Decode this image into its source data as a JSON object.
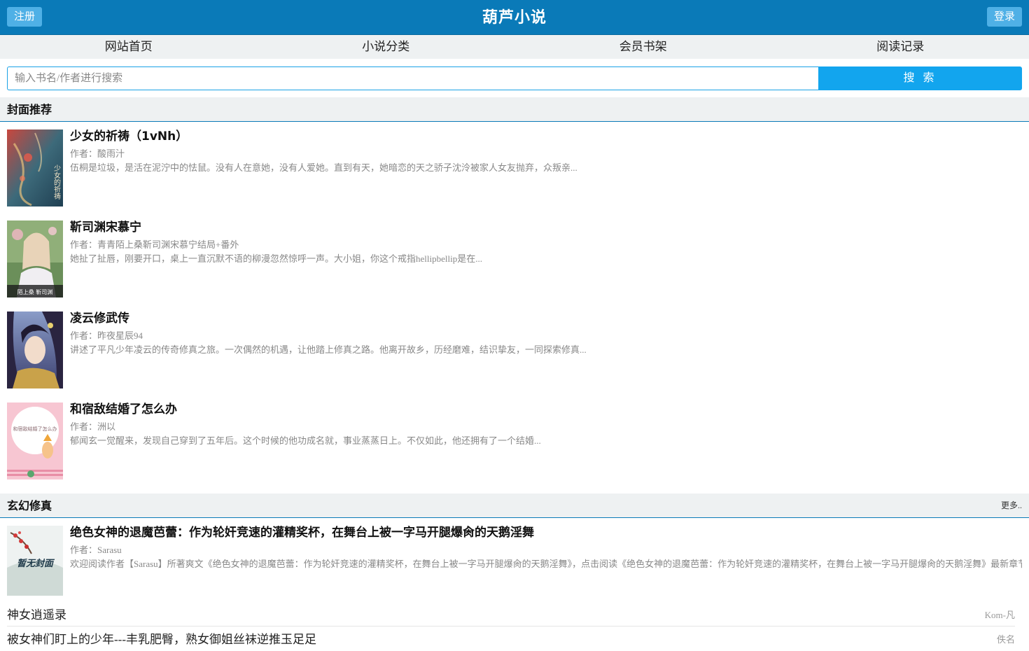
{
  "header": {
    "register_label": "注册",
    "site_title": "葫芦小说",
    "login_label": "登录"
  },
  "nav": [
    {
      "label": "网站首页"
    },
    {
      "label": "小说分类"
    },
    {
      "label": "会员书架"
    },
    {
      "label": "阅读记录"
    }
  ],
  "search": {
    "placeholder": "输入书名/作者进行搜索",
    "button_label": "搜 索"
  },
  "featured": {
    "title": "封面推荐",
    "books": [
      {
        "title": "少女的祈祷（1vNh）",
        "author": "作者：酸雨汁",
        "desc": "伍桐是垃圾，是活在泥泞中的怯鼠。没有人在意她，没有人爱她。直到有天，她暗恋的天之骄子沈泠被家人女友抛弃，众叛亲...",
        "cover_text": "少女的祈祷"
      },
      {
        "title": "靳司渊宋慕宁",
        "author": "作者：青青陌上桑靳司渊宋慕宁结局+番外",
        "desc": "她扯了扯唇，刚要开口，桌上一直沉默不语的柳漫忽然惊呼一声。大小姐，你这个戒指hellipbellip是在...",
        "cover_text": "陌上桑 靳司渊"
      },
      {
        "title": "凌云修武传",
        "author": "作者：昨夜星辰94",
        "desc": "讲述了平凡少年凌云的传奇修真之旅。一次偶然的机遇，让他踏上修真之路。他离开故乡，历经磨难，结识挚友，一同探索修真...",
        "cover_text": ""
      },
      {
        "title": "和宿敌结婚了怎么办",
        "author": "作者：洲以",
        "desc": "郁闻玄一觉醒来，发现自己穿到了五年后。这个时候的他功成名就，事业蒸蒸日上。不仅如此，他还拥有了一个结婚...",
        "cover_text": "和宿敌结婚了怎么办"
      }
    ]
  },
  "xuanhuan": {
    "title": "玄幻修真",
    "more_label": "更多..",
    "top_book": {
      "title": "绝色女神的退魔芭蕾：作为轮奸竞速的灌精奖杯，在舞台上被一字马开腿爆肏的天鹅淫舞",
      "author": "作者：Sarasu",
      "desc": "欢迎阅读作者【Sarasu】所著爽文《绝色女神的退魔芭蕾：作为轮奸竞速的灌精奖杯，在舞台上被一字马开腿爆肏的天鹅淫舞》，点击阅读《绝色女神的退魔芭蕾：作为轮奸竞速的灌精奖杯，在舞台上被一字马开腿爆肏的天鹅淫舞》最新章节",
      "cover_text": "暂无封面"
    },
    "list": [
      {
        "title": "神女逍遥录",
        "author": "Kom-凡"
      },
      {
        "title": "被女神们盯上的少年---丰乳肥臀，熟女御姐丝袜逆推玉足足",
        "author": "佚名"
      }
    ]
  },
  "colors": {
    "header_bg": "#0a7ab8",
    "button_bg": "#4fb0e6",
    "search_button": "#12a5ee",
    "section_bg": "#eef1f2"
  }
}
